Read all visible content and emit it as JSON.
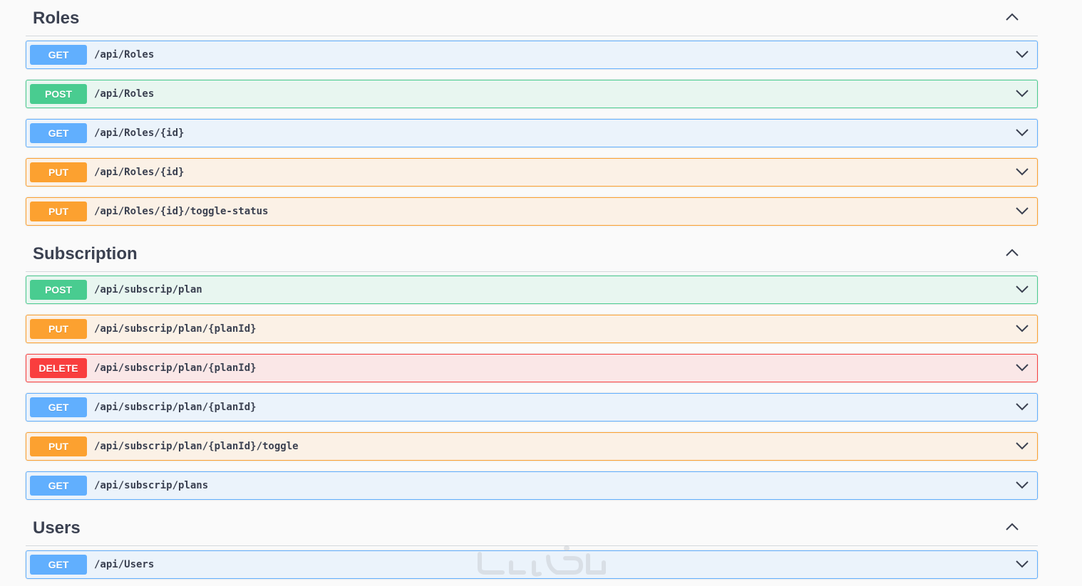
{
  "sections": [
    {
      "title": "Roles",
      "operations": [
        {
          "method": "GET",
          "path": "/api/Roles"
        },
        {
          "method": "POST",
          "path": "/api/Roles"
        },
        {
          "method": "GET",
          "path": "/api/Roles/{id}"
        },
        {
          "method": "PUT",
          "path": "/api/Roles/{id}"
        },
        {
          "method": "PUT",
          "path": "/api/Roles/{id}/toggle-status"
        }
      ]
    },
    {
      "title": "Subscription",
      "operations": [
        {
          "method": "POST",
          "path": "/api/subscrip/plan"
        },
        {
          "method": "PUT",
          "path": "/api/subscrip/plan/{planId}"
        },
        {
          "method": "DELETE",
          "path": "/api/subscrip/plan/{planId}"
        },
        {
          "method": "GET",
          "path": "/api/subscrip/plan/{planId}"
        },
        {
          "method": "PUT",
          "path": "/api/subscrip/plan/{planId}/toggle"
        },
        {
          "method": "GET",
          "path": "/api/subscrip/plans"
        }
      ]
    },
    {
      "title": "Users",
      "operations": [
        {
          "method": "GET",
          "path": "/api/Users"
        }
      ]
    }
  ],
  "colors": {
    "get": "#61affe",
    "post": "#49cc90",
    "put": "#fca130",
    "delete": "#f93e3e",
    "text": "#3b4151"
  },
  "icons": {
    "section_toggle": "chevron-up-icon",
    "operation_toggle": "chevron-down-icon",
    "watermark": "watermark-logo"
  }
}
